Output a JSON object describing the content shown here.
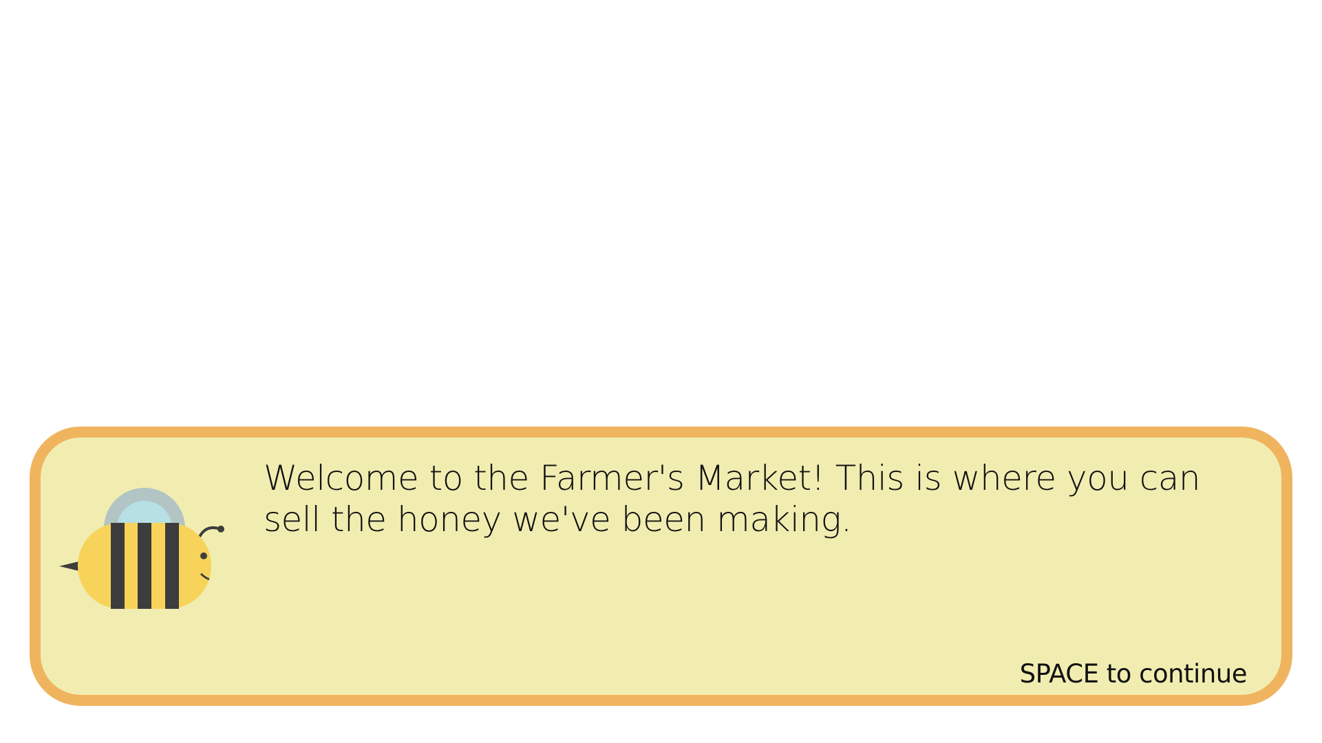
{
  "dialog": {
    "message": "Welcome to the Farmer's Market! This is where you can sell the honey we've been making.",
    "continue_hint": "SPACE to continue"
  },
  "colors": {
    "border": "#f0b45f",
    "panel": "#f1edb1",
    "bee_body": "#f8d35a",
    "bee_stripe": "#3d3d3d",
    "wing_back": "#b2c4c4",
    "wing_front": "#b7e0e4"
  }
}
